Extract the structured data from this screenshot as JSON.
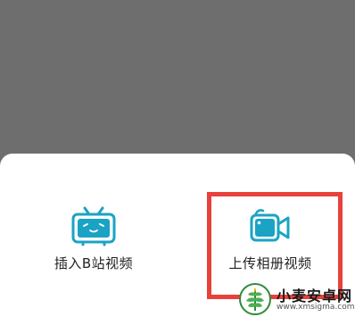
{
  "sheet": {
    "options": [
      {
        "label": "插入B站视频",
        "icon": "bilibili-tv-icon"
      },
      {
        "label": "上传相册视频",
        "icon": "video-camera-icon"
      }
    ]
  },
  "colors": {
    "accent": "#1aa3c4",
    "highlight": "#e8413c",
    "overlay": "#6e6e6e"
  },
  "watermark": {
    "brand": "小麦安卓网",
    "site": "www.xmsigma.com"
  }
}
